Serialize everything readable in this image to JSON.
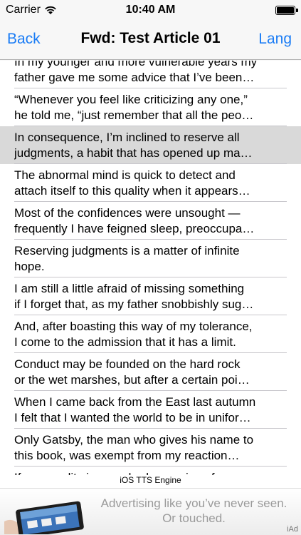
{
  "status_bar": {
    "carrier": "Carrier",
    "time": "10:40 AM"
  },
  "nav": {
    "back_label": "Back",
    "title": "Fwd: Test Article 01",
    "lang_label": "Lang"
  },
  "rows": [
    {
      "line1": "In my younger and more vulnerable years my",
      "line2": "father gave me some advice that I’ve been…",
      "selected": false
    },
    {
      "line1": "“Whenever you feel like criticizing any one,”",
      "line2": "he told me, “just remember that all the peo…",
      "selected": false
    },
    {
      "line1": "In consequence, I’m inclined to reserve all",
      "line2": "judgments, a habit that has opened up ma…",
      "selected": true
    },
    {
      "line1": "The abnormal mind is quick to detect and",
      "line2": "attach itself to this quality when it appears…",
      "selected": false
    },
    {
      "line1": "Most of the confidences were unsought —",
      "line2": "frequently I have feigned sleep, preoccupa…",
      "selected": false
    },
    {
      "line1": "Reserving judgments is a matter of infinite",
      "line2": "hope.",
      "selected": false
    },
    {
      "line1": "I am still a little afraid of missing something",
      "line2": "if I forget that, as my father snobbishly sug…",
      "selected": false
    },
    {
      "line1": "And, after boasting this way of my tolerance,",
      "line2": "I come to the admission that it has a limit.",
      "selected": false
    },
    {
      "line1": "Conduct may be founded on the hard rock",
      "line2": "or the wet marshes, but after a certain poi…",
      "selected": false
    },
    {
      "line1": "When I came back from the East last autumn",
      "line2": "I felt that I wanted the world to be in unifor…",
      "selected": false
    },
    {
      "line1": "Only Gatsby, the man who gives his name to",
      "line2": "this book, was exempt from my reaction…",
      "selected": false
    },
    {
      "line1": "If personality is an unbroken series of",
      "line2": "",
      "selected": false
    }
  ],
  "tts_engine_label": "iOS TTS Engine",
  "ad": {
    "headline": "Advertising like you’ve never seen. Or touched.",
    "brand": "iAd"
  },
  "icons": {
    "wifi": "wifi-icon",
    "battery": "battery-icon",
    "ad_image": "ipad-hand-image"
  },
  "colors": {
    "accent": "#1a7cf5",
    "selected_row": "#d9d9d9",
    "bar_background": "#f7f7f7"
  }
}
